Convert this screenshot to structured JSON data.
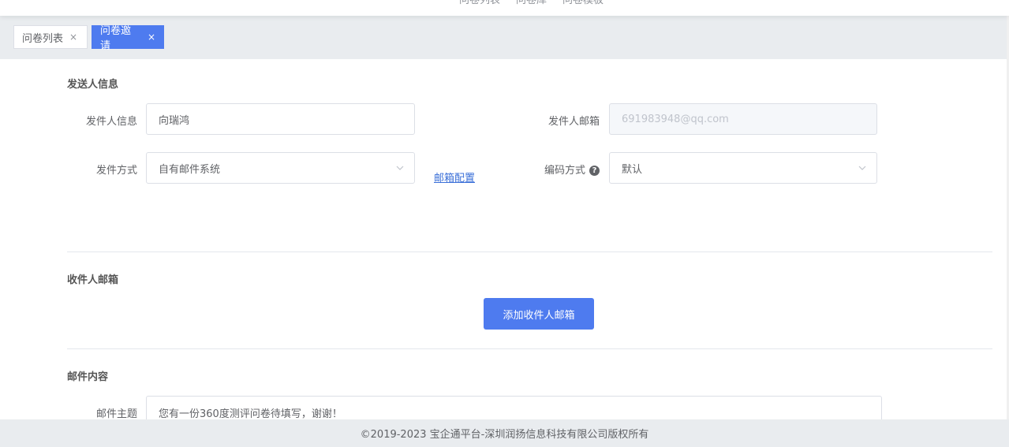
{
  "topnav": [
    "问卷列表",
    "问卷库",
    "问卷模板"
  ],
  "tabs": [
    {
      "label": "问卷列表",
      "close": "×",
      "active": false
    },
    {
      "label": "问卷邀请",
      "close": "×",
      "active": true
    }
  ],
  "sender_section": {
    "title": "发送人信息",
    "sender_info_label": "发件人信息",
    "sender_info_value": "向瑞鸿",
    "sender_email_label": "发件人邮箱",
    "sender_email_placeholder": "691983948@qq.com",
    "send_method_label": "发件方式",
    "send_method_value": "自有邮件系统",
    "email_config_link": "邮箱配置",
    "encoding_label": "编码方式",
    "encoding_help": "?",
    "encoding_value": "默认"
  },
  "recipient_section": {
    "title": "收件人邮箱",
    "add_button": "添加收件人邮箱"
  },
  "content_section": {
    "title": "邮件内容",
    "subject_label": "邮件主题",
    "subject_value": "您有一份360度测评问卷待填写，谢谢！"
  },
  "footer": {
    "copyright": "©2019-2023 宝企通平台-深圳润扬信息科技有限公司版权所有"
  },
  "colors": {
    "primary": "#4e7bef",
    "link": "#3a6fd8"
  }
}
